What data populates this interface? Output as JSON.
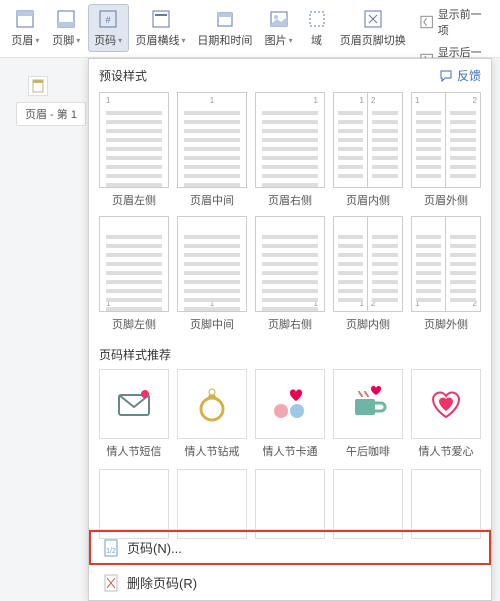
{
  "ribbon": {
    "header_btn": "页眉",
    "footer_btn": "页脚",
    "pagenum_btn": "页码",
    "header_line": "页眉横线",
    "datetime": "日期和时间",
    "picture": "图片",
    "field": "域",
    "hf_switch": "页眉页脚切换",
    "show_prev": "显示前一项",
    "show_next": "显示后一项"
  },
  "doc_tab": "页眉 - 第 1",
  "panel": {
    "preset_title": "预设样式",
    "feedback": "反馈",
    "row1": [
      "页眉左侧",
      "页眉中间",
      "页眉右侧",
      "页眉内侧",
      "页眉外侧"
    ],
    "row2": [
      "页脚左侧",
      "页脚中间",
      "页脚右侧",
      "页脚内侧",
      "页脚外侧"
    ],
    "rec_title": "页码样式推荐",
    "cards": [
      "情人节短信",
      "情人节钻戒",
      "情人节卡通",
      "午后咖啡",
      "情人节爱心"
    ],
    "menu_pagenum": "页码(N)...",
    "menu_delete": "删除页码(R)"
  }
}
